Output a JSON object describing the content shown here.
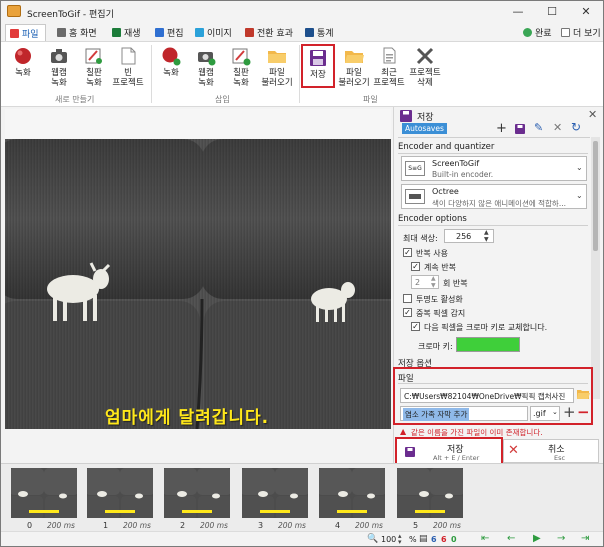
{
  "window": {
    "title": "ScreenToGif - 편집기"
  },
  "tabs": [
    {
      "label": "파일",
      "color": "#e23b3b"
    },
    {
      "label": "홈 화면",
      "color": "#6a6a6a"
    },
    {
      "label": "재생",
      "color": "#1c7c3a"
    },
    {
      "label": "편집",
      "color": "#2f6fd1"
    },
    {
      "label": "이미지",
      "color": "#2aa1d9"
    },
    {
      "label": "전환 효과",
      "color": "#c0392b"
    },
    {
      "label": "통계",
      "color": "#1d4f8c"
    }
  ],
  "tabs_right": {
    "done": "완료",
    "more": "더 보기"
  },
  "ribbon": {
    "new_group": {
      "label": "새로 만들기",
      "buttons": [
        "녹화",
        "웹캠\n녹화",
        "칠판\n녹화",
        "빈\n프로젝트"
      ]
    },
    "insert_group": {
      "label": "삽입",
      "buttons": [
        "녹화",
        "웹캠\n녹화",
        "칠판\n녹화",
        "파일\n불러오기"
      ]
    },
    "file_group": {
      "label": "파일",
      "buttons": [
        "저장",
        "파일\n불러오기",
        "최근\n프로젝트",
        "프로젝트\n삭제"
      ]
    }
  },
  "panel": {
    "title": "저장",
    "autosaves": "Autosaves",
    "encoder_section": "Encoder and quantizer",
    "encoder": {
      "name": "ScreenToGif",
      "desc": "Built-in encoder."
    },
    "quantizer": {
      "name": "Octree",
      "desc": "색이 다양하지 않은 애니메이션에 적합하..."
    },
    "options_section": "Encoder options",
    "max_colors_label": "최대 색상:",
    "max_colors_value": "256",
    "loop": "반복 사용",
    "loop_forever": "계속 반복",
    "repeat_count": "2",
    "repeat_label": "회 반복",
    "transparency": "투명도 활성화",
    "dup_pixels": "중복 픽셀 감지",
    "chroma_replace": "다음 픽셀을 크로마 키로 교체합니다.",
    "chroma_label": "크로마 키:",
    "chroma_color": "#3fcf3a",
    "save_options": "저장 옵션",
    "file_section": "파일",
    "path": "C:₩Users₩82104₩OneDrive₩픽픽 캡처사진",
    "filename": "염소 가족 자막 추가",
    "extension": ".gif",
    "warning": "같은 이름을 가진 파일이 이미 존재합니다.",
    "save_button": "저장",
    "save_shortcut": "Alt + E / Enter",
    "cancel_button": "취소",
    "cancel_shortcut": "Esc"
  },
  "video": {
    "subtitle": "엄마에게 달려갑니다."
  },
  "frames": [
    {
      "index": "0",
      "duration": "200 ms"
    },
    {
      "index": "1",
      "duration": "200 ms"
    },
    {
      "index": "2",
      "duration": "200 ms"
    },
    {
      "index": "3",
      "duration": "200 ms"
    },
    {
      "index": "4",
      "duration": "200 ms"
    },
    {
      "index": "5",
      "duration": "200 ms"
    }
  ],
  "status": {
    "zoom": "100",
    "percent": "%",
    "frame_total": "6",
    "frame_selected": "6",
    "frame_current": "0"
  }
}
